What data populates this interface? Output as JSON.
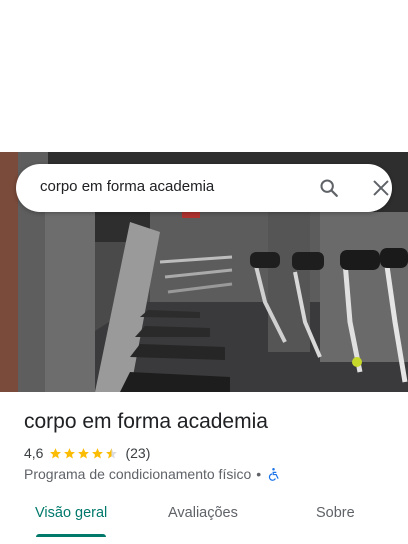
{
  "search": {
    "query": "corpo em forma academia"
  },
  "place": {
    "name": "corpo em forma academia",
    "rating": "4,6",
    "stars_filled": 4.5,
    "review_count": "(23)",
    "category": "Programa de condicionamento físico",
    "separator": "•"
  },
  "tabs": [
    {
      "label": "Visão geral",
      "active": true
    },
    {
      "label": "Avaliações",
      "active": false
    },
    {
      "label": "Sobre",
      "active": false
    }
  ],
  "colors": {
    "accent": "#00796b",
    "star": "#fbbc04",
    "wheelchair": "#1a73e8"
  },
  "icons": {
    "search": "search-icon",
    "close": "close-icon",
    "accessibility": "wheelchair-icon"
  }
}
